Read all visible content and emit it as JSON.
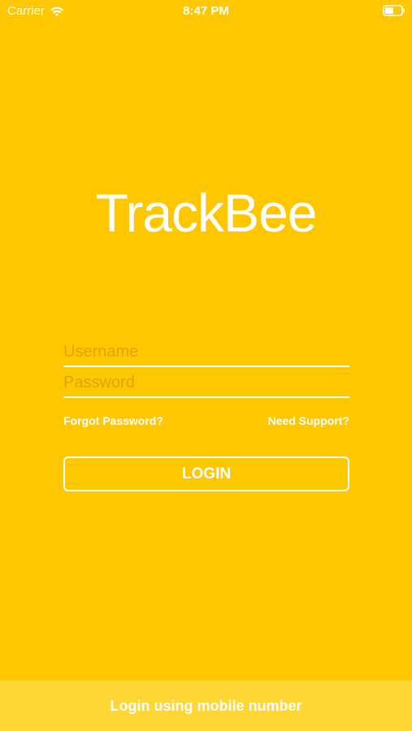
{
  "status_bar": {
    "carrier": "Carrier",
    "time": "8:47 PM"
  },
  "brand": {
    "name": "TrackBee"
  },
  "form": {
    "username_placeholder": "Username",
    "username_value": "",
    "password_placeholder": "Password",
    "password_value": "",
    "forgot_password": "Forgot Password?",
    "need_support": "Need Support?",
    "login_label": "LOGIN"
  },
  "footer": {
    "mobile_login": "Login using mobile number"
  },
  "colors": {
    "background": "#ffc700",
    "footer_bar": "#ffd633",
    "text": "#ffffff",
    "placeholder": "#d9a800"
  },
  "icons": {
    "signal": "wifi-icon",
    "battery": "battery-icon"
  }
}
